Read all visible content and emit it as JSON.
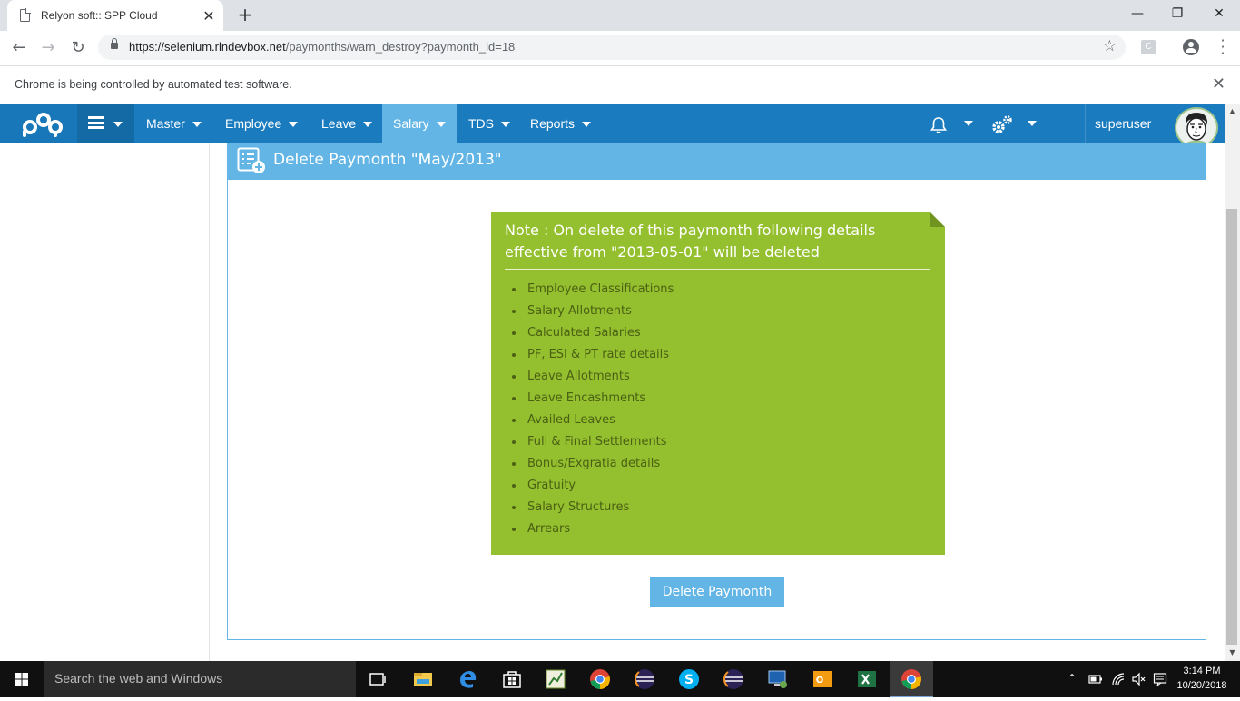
{
  "browser": {
    "tab_title": "Relyon soft:: SPP Cloud",
    "tab_close": "✕",
    "new_tab": "+",
    "url_host": "https://selenium.rlndevbox.net",
    "url_path": "/paymonths/warn_destroy?paymonth_id=18",
    "infobar_text": "Chrome is being controlled by automated test software.",
    "extension_letter": "C"
  },
  "nav": {
    "items": [
      {
        "label": "Master"
      },
      {
        "label": "Employee"
      },
      {
        "label": "Leave"
      },
      {
        "label": "Salary",
        "active": true
      },
      {
        "label": "TDS"
      },
      {
        "label": "Reports"
      }
    ],
    "username": "superuser"
  },
  "page": {
    "title": "Delete Paymonth \"May/2013\"",
    "note_heading": "Note : On delete of this paymonth following details effective from \"2013-05-01\" will be deleted",
    "items": [
      "Employee Classifications",
      "Salary Allotments",
      "Calculated Salaries",
      "PF, ESI & PT rate details",
      "Leave Allotments",
      "Leave Encashments",
      "Availed Leaves",
      "Full & Final Settlements",
      "Bonus/Exgratia details",
      "Gratuity",
      "Salary Structures",
      "Arrears"
    ],
    "delete_button": "Delete Paymonth"
  },
  "taskbar": {
    "search_placeholder": "Search the web and Windows",
    "time": "3:14 PM",
    "date": "10/20/2018"
  },
  "colors": {
    "nav_bg": "#1a7bbf",
    "accent": "#62b5e5",
    "note_bg": "#94bf2e"
  }
}
